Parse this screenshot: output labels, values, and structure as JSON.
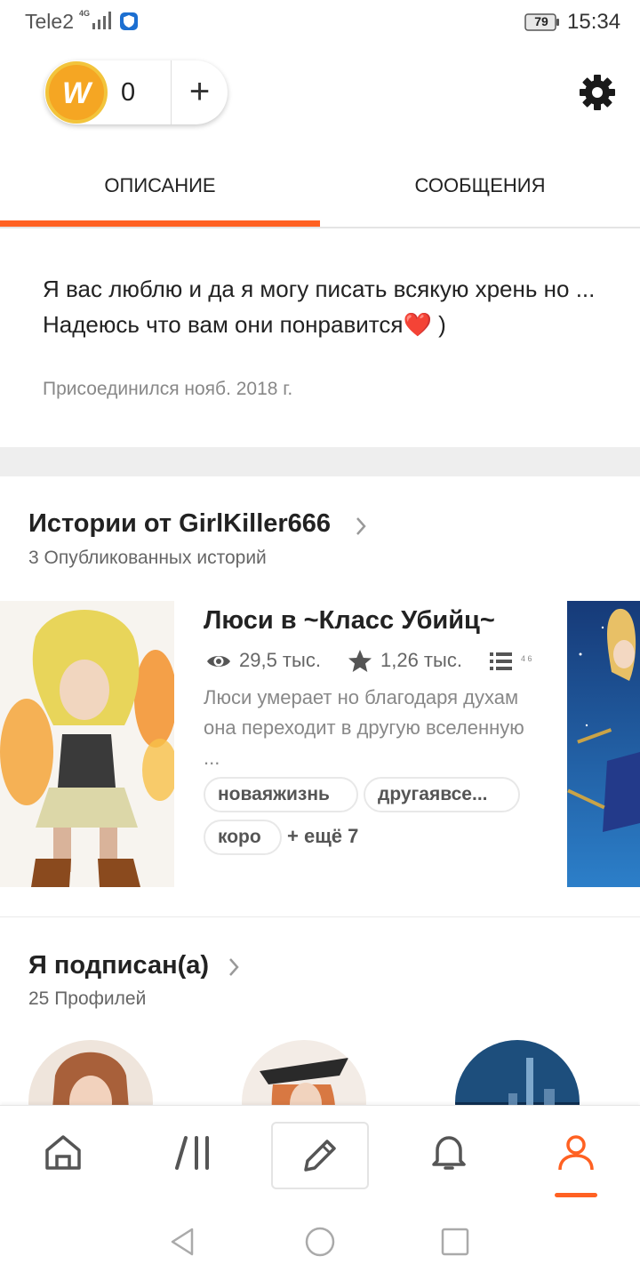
{
  "status_bar": {
    "carrier": "Tele2",
    "network": "4G",
    "battery": "79",
    "time": "15:34"
  },
  "header": {
    "coin_count": "0",
    "add_label": "+",
    "coin_letter": "W"
  },
  "tabs": [
    {
      "label": "ОПИСАНИЕ",
      "active": true
    },
    {
      "label": "СООБЩЕНИЯ",
      "active": false
    }
  ],
  "about": {
    "bio_line1": "Я вас люблю и да я могу писать всякую хрень но ...",
    "bio_line2": "Надеюсь что вам они понравится❤️ )",
    "joined": "Присоединился нояб. 2018 г."
  },
  "stories": {
    "title": "Истории от GirlKiller666",
    "subtitle": "3 Опубликованных историй",
    "items": [
      {
        "title": "Люси в ~Класс Убийц~",
        "reads": "29,5 тыс.",
        "votes": "1,26 тыс.",
        "parts_partial": "4 6",
        "description": "Люси умерает но благодаря духам она переходит в другую вселенную ...",
        "tags": [
          "новаяжизнь",
          "другаявсе...",
          "коро"
        ],
        "more_tags": "+ ещё 7"
      }
    ]
  },
  "following": {
    "title": "Я подписан(а)",
    "subtitle": "25 Профилей"
  },
  "colors": {
    "accent": "#ff6122",
    "coin": "#f5a623",
    "separator": "#eeeeee"
  },
  "nav": {
    "items": [
      "home-icon",
      "library-icon",
      "write-icon",
      "bell-icon",
      "profile-icon"
    ],
    "active": "profile-icon"
  }
}
